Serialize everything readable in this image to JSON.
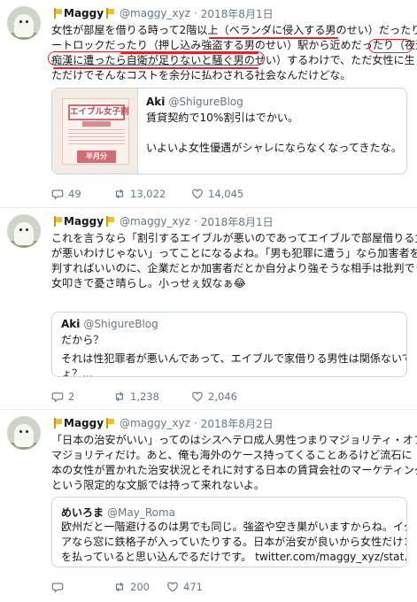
{
  "tweets": [
    {
      "name": "Maggy",
      "handle": "@maggy_xyz",
      "sep": "·",
      "date": "2018年8月1日",
      "lines": [
        "女性が部屋を借りる時って2階以上（ベランダに侵入する男のせい）だったりオ",
        "ートロックだったり（押し込み強盗する男のせい）駅から近めだったり（夜道で",
        "痴漢に遭ったら自衛が足りないと騒ぐ男のせい）するわけで、ただ女性に生まれ",
        "ただけでそんなコストを余分に払わされる社会なんだけどな。"
      ],
      "quote": {
        "name": "Aki",
        "handle": "@ShigureBlog",
        "lines": [
          "賃貸契約で10%割引はでかい。",
          "",
          "いよいよ女性優遇がシャレにならなくなってきたな。"
        ],
        "thumb": {
          "title": "エイブル女子割",
          "badge": "半月分"
        }
      },
      "replies": "49",
      "retweets": "13,022",
      "likes": "14,045"
    },
    {
      "name": "Maggy",
      "handle": "@maggy_xyz",
      "sep": "·",
      "date": "2018年8月1日",
      "lines": [
        "これを言うなら「割引するエイブルが悪いのであってエイブルで部屋借りる女性",
        "が悪いわけじゃない」ってことになるよね。「男も犯罪に遭う」なら加害者を批",
        "判すればいいのに、企業だとか加害者だとか自分より強そうな相手は批判できず",
        "女叩きで憂さ晴らし。小っせぇ奴なぁ😂"
      ],
      "quote": {
        "name": "Aki",
        "handle": "@ShigureBlog",
        "lines": [
          "だから？",
          "",
          "それは性犯罪者が悪いんであって、エイブルで家借りる男性は関係ないでしょ",
          "ょ？..."
        ]
      },
      "replies": "2",
      "retweets": "1,238",
      "likes": "2,046"
    },
    {
      "name": "Maggy",
      "handle": "@maggy_xyz",
      "sep": "·",
      "date": "2018年8月2日",
      "lines": [
        "「日本の治安がいい」ってのはシスヘテロ成人男性つまりマジョリティ・オブ・",
        "マジョリティだけ。あと、俺も海外のケース持ってくることあるけど流石に「日",
        "本の女性が置かれた治安状況とそれに対する日本の賃貸会社のマーケティング」",
        "という限定的な文脈では持って来れないよ。"
      ],
      "quote": {
        "name": "めいろま",
        "handle": "@May_Roma",
        "lines": [
          "欧州だと一階避けるのは男でも同じ。強盗や空き巣がいますからね。イタリ",
          "アなら窓に鉄格子が入っていたりする。日本が治安が良いから女性だけコスト",
          "を払っていると思い込んでるだけです。 twitter.com/maggy_xyz/stat..."
        ]
      },
      "replies": "",
      "retweets": "200",
      "likes": "471"
    }
  ],
  "icons": {
    "reply": "reply-icon",
    "retweet": "retweet-icon",
    "like": "heart-icon",
    "flag": "yellow-flag-icon"
  },
  "colors": {
    "highlight": "#e0232a",
    "muted": "#657786",
    "border": "#e6ecf0"
  }
}
